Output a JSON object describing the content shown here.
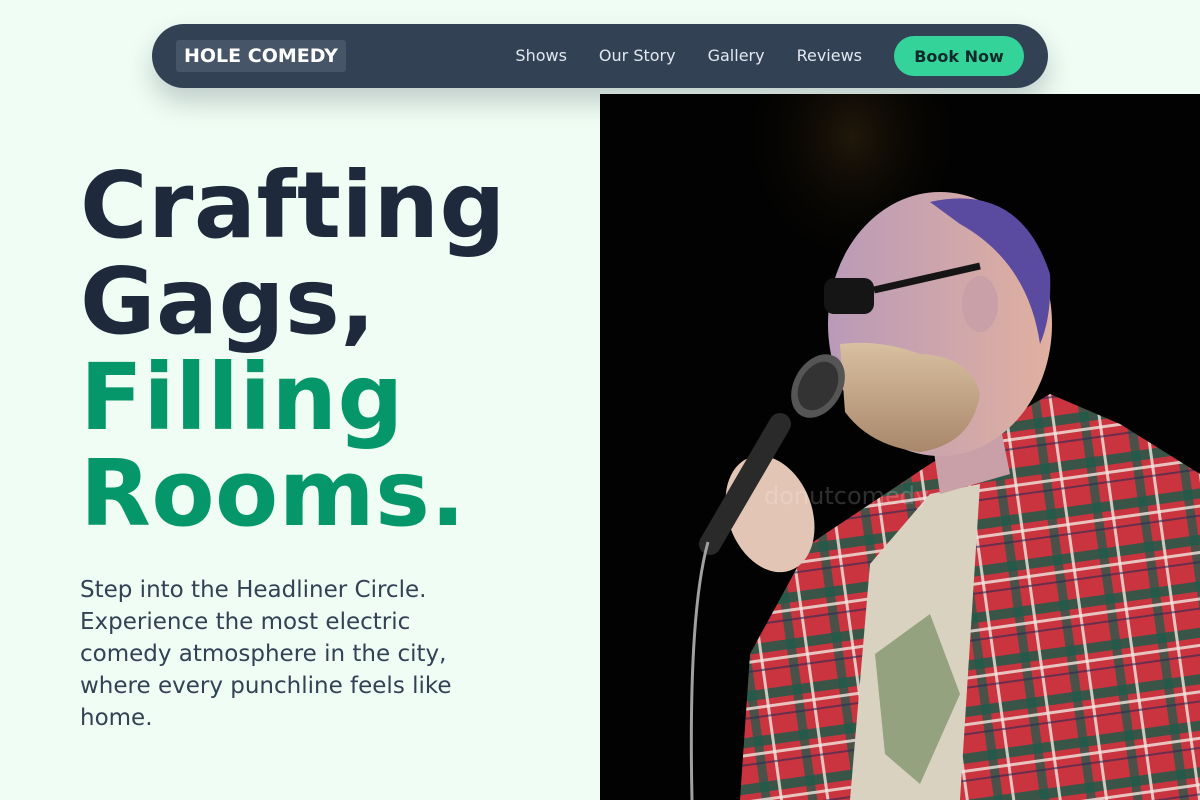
{
  "nav": {
    "logo": "HOLE COMEDY",
    "links": [
      "Shows",
      "Our Story",
      "Gallery",
      "Reviews"
    ],
    "cta": "Book Now"
  },
  "hero": {
    "headline_line1": "Crafting",
    "headline_line2": "Gags,",
    "headline_line3": "Filling",
    "headline_line4": "Rooms.",
    "subtitle": "Step into the Headliner Circle. Experience the most electric comedy atmosphere in the city, where every punchline feels like home."
  },
  "photo": {
    "watermark": "donutcomedy"
  },
  "colors": {
    "background": "#effdf4",
    "nav": "#334155",
    "accent": "#34d399",
    "headline_dark": "#1e293b",
    "headline_green": "#059669"
  }
}
